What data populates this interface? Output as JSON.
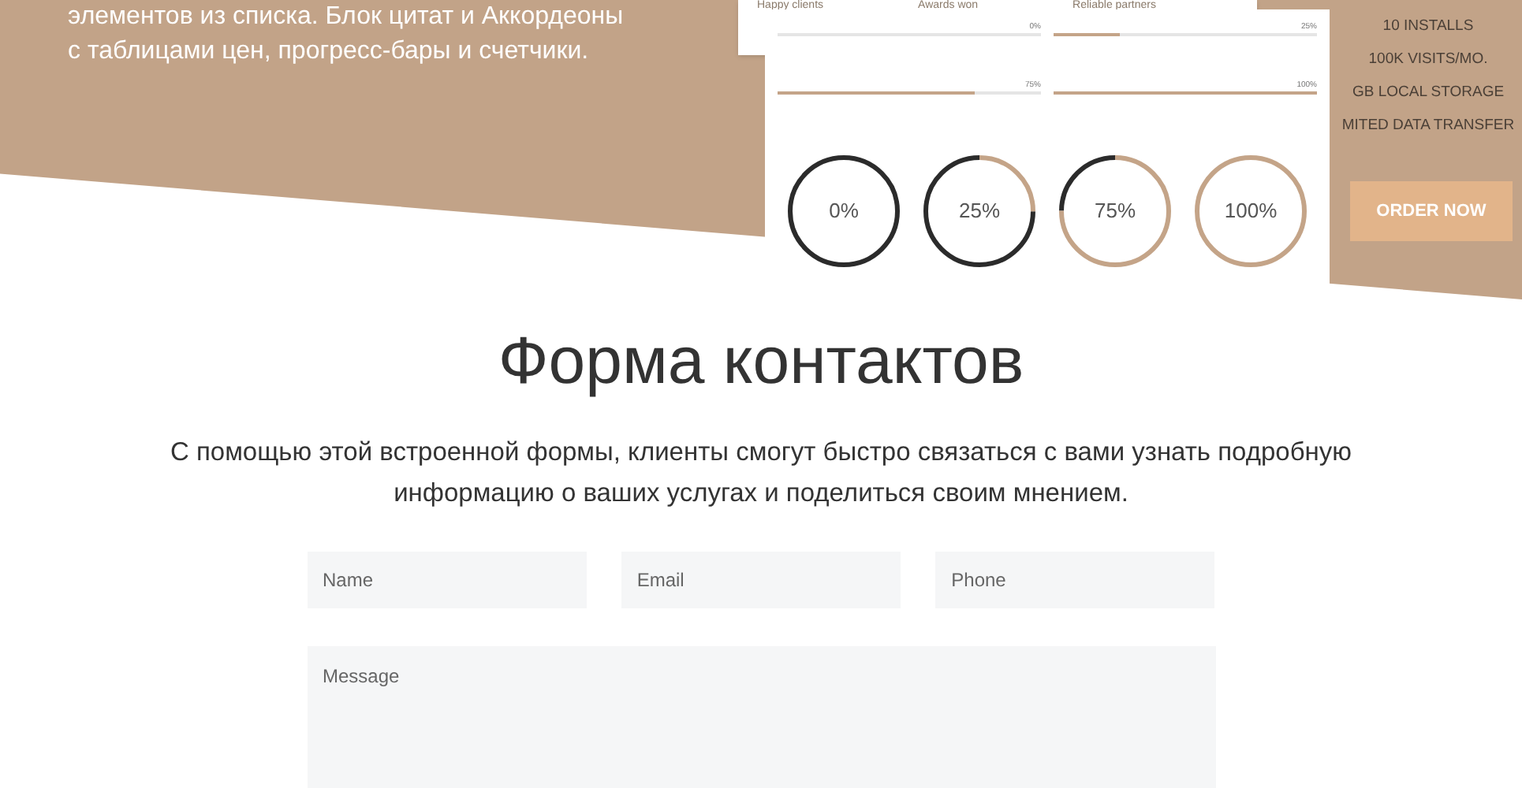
{
  "hero": {
    "lines": [
      "элементов из списка. Блок цитат и Аккордеоны",
      "с таблицами цен, прогресс-бары и счетчики."
    ]
  },
  "mockup": {
    "counter_labels": [
      "Happy clients",
      "Awards won",
      "Reliable partners"
    ],
    "bars": [
      {
        "label": "0%",
        "level": 0
      },
      {
        "label": "25%",
        "level": 0.25
      },
      {
        "label": "75%",
        "level": 0.75
      },
      {
        "label": "100%",
        "level": 1
      }
    ],
    "circles": [
      {
        "label": "0%",
        "level": 0
      },
      {
        "label": "25%",
        "level": 0.25
      },
      {
        "label": "75%",
        "level": 0.75
      },
      {
        "label": "100%",
        "level": 1
      }
    ]
  },
  "pricing": {
    "features": [
      "10 INSTALLS",
      "100K VISITS/MO.",
      "GB LOCAL STORAGE",
      "MITED DATA TRANSFER"
    ],
    "button": "ORDER NOW"
  },
  "contact": {
    "title": "Форма контактов",
    "description": "С помощью этой встроенной формы, клиенты смогут быстро связаться с вами узнать подробную информацию о ваших услугах и поделиться своим мнением.",
    "fields": [
      {
        "placeholder": "Name"
      },
      {
        "placeholder": "Email"
      },
      {
        "placeholder": "Phone"
      }
    ],
    "message": {
      "placeholder": "Message"
    }
  }
}
